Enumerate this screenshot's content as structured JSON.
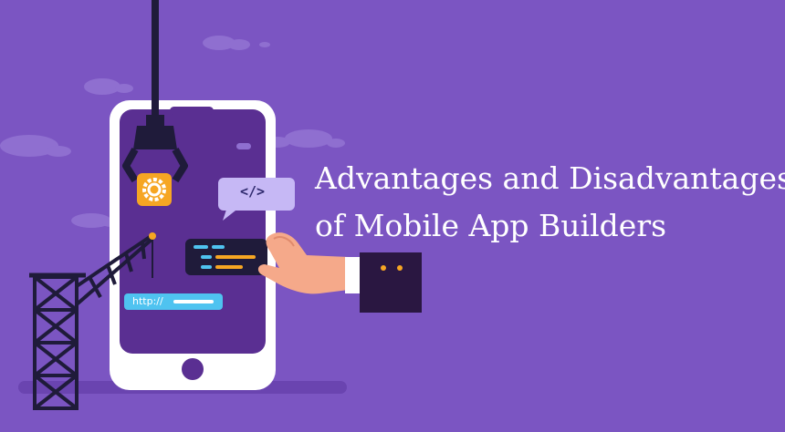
{
  "title": {
    "line1": "Advantages and Disadvantages",
    "line2": "of Mobile App Builders"
  },
  "code_bubble": {
    "text": "</>"
  },
  "url_bar": {
    "text": "http://"
  },
  "colors": {
    "background": "#7b55c2",
    "phone_body": "#ffffff",
    "phone_screen": "#5a2f92",
    "gear_badge": "#f6a623",
    "url_bar": "#4fc3f0",
    "code_panel": "#1f1b3a",
    "sleeve": "#2a1741",
    "skin": "#f5a98a"
  },
  "icons": [
    "cloud-icon",
    "crane-hook-icon",
    "gear-icon",
    "code-bubble-icon",
    "code-snippet-icon",
    "crane-tower-icon",
    "hand-icon",
    "home-button-icon"
  ]
}
